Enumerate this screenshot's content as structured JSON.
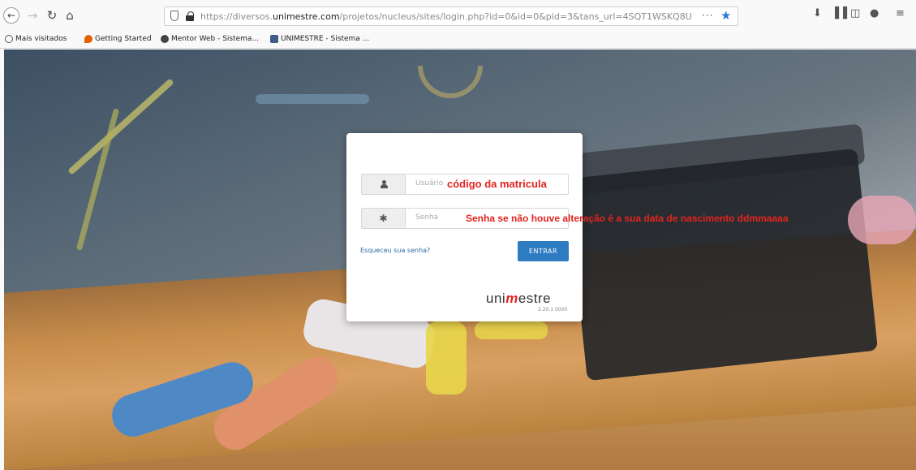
{
  "browser": {
    "url_prefix": "https://",
    "url_domain": "unimestre.com",
    "url_host_pre": "diversos.",
    "url_path": "/projetos/nucleus/sites/login.php?id=0&id=0&pid=3&tans_url=4SQT1WSKQ8U",
    "menu_dots": "···",
    "bookmarks": [
      {
        "label": "Mais visitados",
        "icon": "gear-icon"
      },
      {
        "label": "Getting Started",
        "icon": "firefox-icon"
      },
      {
        "label": "Mentor Web - Sistema...",
        "icon": "globe-icon"
      },
      {
        "label": "UNIMESTRE - Sistema ...",
        "icon": "unimestre-icon"
      }
    ]
  },
  "login": {
    "user_placeholder": "Usuário",
    "password_placeholder": "Senha",
    "forgot_label": "Esqueceu sua senha?",
    "enter_label": "ENTRAR",
    "logo_pre": "uni",
    "logo_mark": "m",
    "logo_post": "estre",
    "version": "2.20.1 0000"
  },
  "annotations": {
    "user": "código da matricula",
    "password": "Senha se não houve alteração é a sua data de nascimento ddmmaaaa"
  },
  "colors": {
    "accent_blue": "#2d7cc1",
    "annotation_red": "#e3231e",
    "bookmark_star": "#2a7ad2"
  }
}
